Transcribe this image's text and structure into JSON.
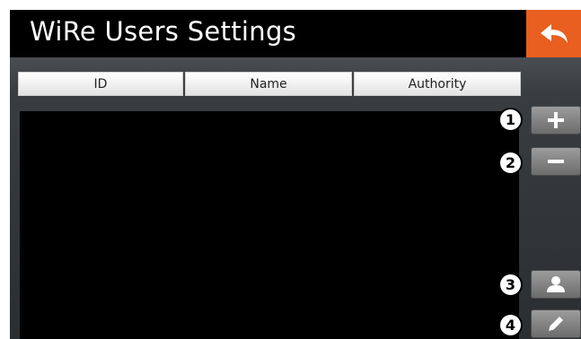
{
  "header": {
    "title": "WiRe Users Settings",
    "back_icon": "back-arrow-icon",
    "accent_color": "#e85f1f"
  },
  "table": {
    "columns": [
      "ID",
      "Name",
      "Authority"
    ],
    "rows": []
  },
  "side_buttons": [
    {
      "badge": "1",
      "icon": "plus-icon"
    },
    {
      "badge": "2",
      "icon": "minus-icon"
    },
    {
      "badge": "3",
      "icon": "user-icon"
    },
    {
      "badge": "4",
      "icon": "pencil-icon"
    }
  ]
}
